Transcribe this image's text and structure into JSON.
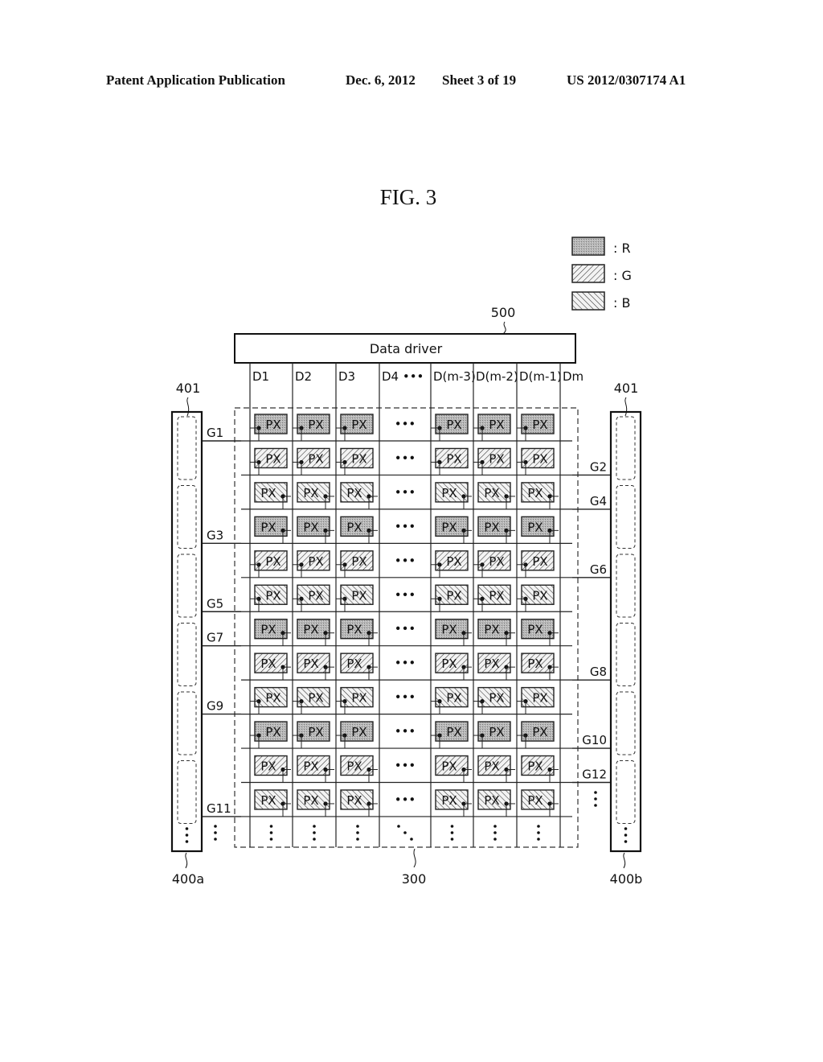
{
  "header": {
    "publication": "Patent Application Publication",
    "date": "Dec. 6, 2012",
    "sheet": "Sheet 3 of 19",
    "patent_number": "US 2012/0307174 A1"
  },
  "figure": {
    "title": "FIG. 3"
  },
  "legend": [
    {
      "key": "R",
      "label": ": R",
      "pattern": "dotted-gray"
    },
    {
      "key": "G",
      "label": ": G",
      "pattern": "hatch-forward"
    },
    {
      "key": "B",
      "label": ": B",
      "pattern": "hatch-backward"
    }
  ],
  "data_driver": {
    "label": "Data driver",
    "ref": "500"
  },
  "data_lines": [
    "D1",
    "D2",
    "D3",
    "D4 •••",
    "D(m-3)",
    "D(m-2)",
    "D(m-1)",
    "Dm"
  ],
  "pixel_label": "PX",
  "display_panel_ref": "300",
  "gate_driver_left": {
    "ref": "400a",
    "stage_ref": "401"
  },
  "gate_driver_right": {
    "ref": "400b",
    "stage_ref": "401"
  },
  "gate_lines_left": [
    "G1",
    "G3",
    "G5",
    "G7",
    "G9",
    "G11"
  ],
  "gate_lines_right": [
    "G2",
    "G4",
    "G6",
    "G8",
    "G10",
    "G12"
  ],
  "pixel_rows": [
    {
      "color": "R",
      "dot": "left"
    },
    {
      "color": "G",
      "dot": "left"
    },
    {
      "color": "B",
      "dot": "right"
    },
    {
      "color": "R",
      "dot": "right"
    },
    {
      "color": "G",
      "dot": "left"
    },
    {
      "color": "B",
      "dot": "left"
    },
    {
      "color": "R",
      "dot": "right"
    },
    {
      "color": "G",
      "dot": "right"
    },
    {
      "color": "B",
      "dot": "left"
    },
    {
      "color": "R",
      "dot": "left"
    },
    {
      "color": "G",
      "dot": "right"
    },
    {
      "color": "B",
      "dot": "right"
    }
  ],
  "ellipsis": "•••",
  "colors": {
    "ink": "#111111",
    "red_fill": "#b8b8b8",
    "hatch_bg": "#ececec"
  }
}
